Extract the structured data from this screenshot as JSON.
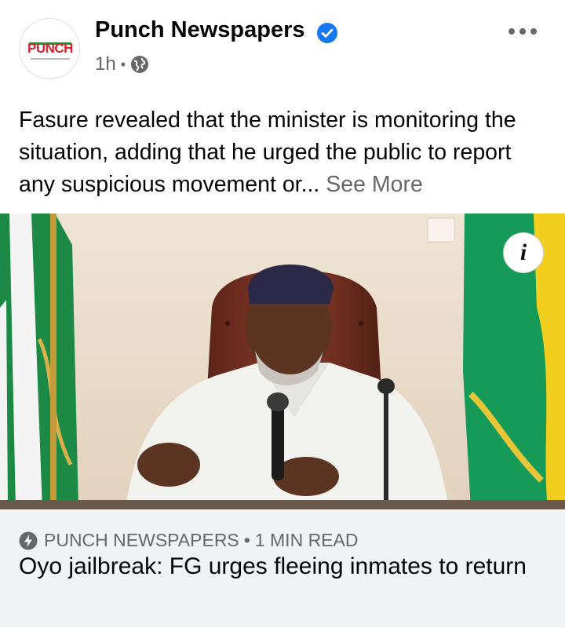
{
  "post": {
    "page_name": "Punch Newspapers",
    "avatar_logo_text": "PUNCH",
    "time_ago": "1h",
    "separator": "•",
    "privacy_icon": "globe-icon",
    "verified_icon": "verified-badge-icon",
    "more_icon": "more-horizontal-icon",
    "caption": "Fasure revealed that the minister is monitoring the situation, adding that he urged the public to report any suspicious movement or...",
    "see_more": "See More"
  },
  "link_preview": {
    "info_label": "i",
    "source_icon": "lightning-bolt-icon",
    "source": "PUNCH NEWSPAPERS",
    "separator": "•",
    "read_time": "1 MIN READ",
    "headline": "Oyo jailbreak: FG urges fleeing inmates to return"
  },
  "colors": {
    "verified_blue": "#1877f2",
    "secondary_text": "#65676b",
    "card_background": "#f0f2f5",
    "punch_red": "#d4202f"
  }
}
